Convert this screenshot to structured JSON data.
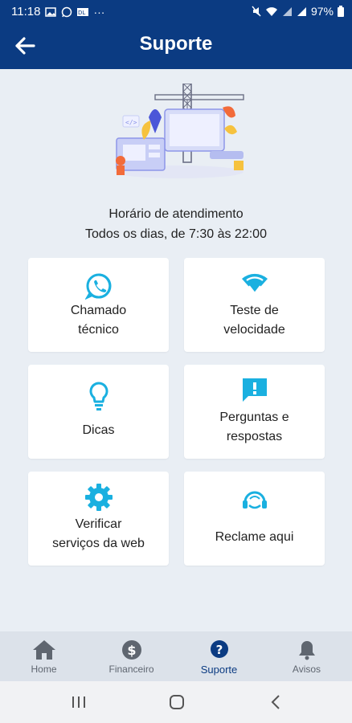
{
  "status_bar": {
    "time": "11:18",
    "battery": "97%",
    "more": "···"
  },
  "header": {
    "title": "Suporte"
  },
  "hours": {
    "line1": "Horário de atendimento",
    "line2": "Todos os dias, de 7:30 às 22:00"
  },
  "cards": [
    {
      "label": "Chamado\ntécnico",
      "icon": "whatsapp-icon"
    },
    {
      "label": "Teste de\nvelocidade",
      "icon": "wifi-icon"
    },
    {
      "label": "Dicas",
      "icon": "lightbulb-icon"
    },
    {
      "label": "Perguntas e\nrespostas",
      "icon": "chat-alert-icon"
    },
    {
      "label": "Verificar\nserviços  da web",
      "icon": "gear-icon"
    },
    {
      "label": "Reclame aqui",
      "icon": "headset-icon"
    }
  ],
  "nav": [
    {
      "label": "Home",
      "icon": "home-icon"
    },
    {
      "label": "Financeiro",
      "icon": "dollar-icon"
    },
    {
      "label": "Suporte",
      "icon": "question-icon",
      "active": true
    },
    {
      "label": "Avisos",
      "icon": "bell-icon"
    }
  ],
  "colors": {
    "primary": "#0b3b82",
    "accent": "#1ab0e0",
    "background": "#e9eef4"
  }
}
